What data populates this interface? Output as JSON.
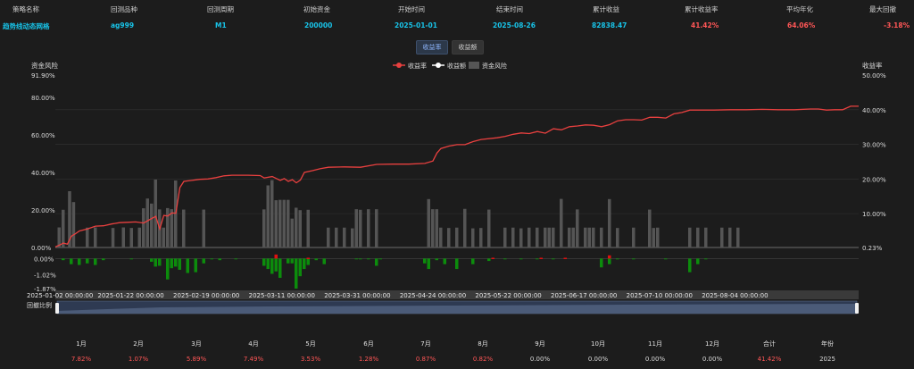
{
  "header": {
    "labels": [
      "策略名称",
      "回测品种",
      "回测周期",
      "初始资金",
      "开始时间",
      "结束时间",
      "累计收益",
      "累计收益率",
      "平均年化",
      "最大回撤"
    ],
    "values": [
      "趋势线动态网格",
      "ag999",
      "M1",
      "200000",
      "2025-01-01",
      "2025-08-26",
      "82838.47",
      "41.42%",
      "64.06%",
      "-3.18%"
    ]
  },
  "toggle": {
    "returns_rate": "收益率",
    "returns_amount": "收益额"
  },
  "chart_data": {
    "type": "line",
    "legend": [
      "收益率",
      "收益额",
      "资金风险"
    ],
    "legend_position": "top-center",
    "left_axis_title": "资金风险",
    "right_axis_title": "收益率",
    "left_ticks": [
      "91.90%",
      "80.00%",
      "60.00%",
      "40.00%",
      "20.00%",
      "0.00%"
    ],
    "right_ticks": [
      "50.00%",
      "40.00%",
      "30.00%",
      "20.00%",
      "10.00%",
      "0.23%"
    ],
    "right_ylim": [
      0.23,
      50.0
    ],
    "left_ylim": [
      0,
      91.9
    ],
    "sub_ticks": [
      "0.00%",
      "-1.02%",
      "-1.87%"
    ],
    "sub_ylim": [
      -1.87,
      0.3
    ],
    "x_ticks": [
      "2025-01-02 00:00:00",
      "2025-01-22 00:00:00",
      "2025-02-19 00:00:00",
      "2025-03-11 00:00:00",
      "2025-03-31 00:00:00",
      "2025-04-24 00:00:00",
      "2025-05-22 00:00:00",
      "2025-06-17 00:00:00",
      "2025-07-10 00:00:00",
      "2025-08-04 00:00:00"
    ],
    "slider_label": "回撤比例",
    "returns_series": [
      [
        0,
        0.4
      ],
      [
        0.005,
        0.9
      ],
      [
        0.01,
        1.5
      ],
      [
        0.015,
        1.2
      ],
      [
        0.02,
        3.5
      ],
      [
        0.025,
        4.2
      ],
      [
        0.03,
        5.0
      ],
      [
        0.04,
        5.6
      ],
      [
        0.05,
        6.4
      ],
      [
        0.06,
        6.5
      ],
      [
        0.07,
        7.0
      ],
      [
        0.08,
        7.4
      ],
      [
        0.09,
        7.5
      ],
      [
        0.1,
        7.6
      ],
      [
        0.11,
        7.3
      ],
      [
        0.12,
        8.6
      ],
      [
        0.125,
        9.2
      ],
      [
        0.13,
        5.6
      ],
      [
        0.135,
        9.5
      ],
      [
        0.14,
        9.3
      ],
      [
        0.145,
        10.2
      ],
      [
        0.15,
        10.1
      ],
      [
        0.155,
        17.5
      ],
      [
        0.16,
        19.3
      ],
      [
        0.17,
        19.6
      ],
      [
        0.18,
        19.9
      ],
      [
        0.19,
        20.0
      ],
      [
        0.2,
        20.4
      ],
      [
        0.21,
        20.9
      ],
      [
        0.22,
        21.1
      ],
      [
        0.24,
        21.1
      ],
      [
        0.255,
        21.0
      ],
      [
        0.26,
        20.3
      ],
      [
        0.27,
        20.7
      ],
      [
        0.28,
        19.6
      ],
      [
        0.285,
        20.1
      ],
      [
        0.29,
        19.3
      ],
      [
        0.295,
        19.8
      ],
      [
        0.3,
        18.9
      ],
      [
        0.305,
        19.7
      ],
      [
        0.31,
        21.9
      ],
      [
        0.32,
        22.4
      ],
      [
        0.33,
        23.0
      ],
      [
        0.34,
        23.4
      ],
      [
        0.36,
        23.5
      ],
      [
        0.38,
        23.4
      ],
      [
        0.4,
        24.2
      ],
      [
        0.42,
        24.3
      ],
      [
        0.44,
        24.3
      ],
      [
        0.46,
        24.5
      ],
      [
        0.47,
        25.2
      ],
      [
        0.475,
        27.5
      ],
      [
        0.48,
        28.8
      ],
      [
        0.49,
        29.5
      ],
      [
        0.5,
        29.9
      ],
      [
        0.51,
        29.9
      ],
      [
        0.52,
        30.8
      ],
      [
        0.53,
        31.4
      ],
      [
        0.55,
        31.9
      ],
      [
        0.56,
        32.3
      ],
      [
        0.57,
        32.9
      ],
      [
        0.58,
        33.3
      ],
      [
        0.59,
        33.1
      ],
      [
        0.6,
        33.7
      ],
      [
        0.61,
        33.2
      ],
      [
        0.62,
        34.5
      ],
      [
        0.63,
        34.2
      ],
      [
        0.64,
        35.1
      ],
      [
        0.65,
        35.3
      ],
      [
        0.66,
        35.6
      ],
      [
        0.67,
        35.5
      ],
      [
        0.68,
        35.1
      ],
      [
        0.69,
        35.7
      ],
      [
        0.7,
        36.8
      ],
      [
        0.71,
        37.1
      ],
      [
        0.72,
        37.1
      ],
      [
        0.73,
        37.0
      ],
      [
        0.74,
        37.8
      ],
      [
        0.75,
        37.8
      ],
      [
        0.76,
        37.6
      ],
      [
        0.77,
        38.8
      ],
      [
        0.78,
        39.2
      ],
      [
        0.79,
        39.9
      ],
      [
        0.8,
        39.9
      ],
      [
        0.82,
        39.9
      ],
      [
        0.84,
        40.0
      ],
      [
        0.86,
        40.0
      ],
      [
        0.88,
        40.1
      ],
      [
        0.9,
        40.0
      ],
      [
        0.92,
        40.0
      ],
      [
        0.94,
        40.2
      ],
      [
        0.95,
        40.2
      ],
      [
        0.96,
        39.9
      ],
      [
        0.97,
        40.0
      ],
      [
        0.98,
        40.0
      ],
      [
        0.99,
        41.0
      ],
      [
        1.0,
        41.0
      ]
    ],
    "risk_bars": [
      [
        0.005,
        10.7
      ],
      [
        0.01,
        20.1
      ],
      [
        0.018,
        30.0
      ],
      [
        0.023,
        24.2
      ],
      [
        0.04,
        10.6
      ],
      [
        0.05,
        10.7
      ],
      [
        0.072,
        10.4
      ],
      [
        0.085,
        10.7
      ],
      [
        0.095,
        10.4
      ],
      [
        0.105,
        10.6
      ],
      [
        0.11,
        20.9
      ],
      [
        0.115,
        26.1
      ],
      [
        0.12,
        23.4
      ],
      [
        0.125,
        36.2
      ],
      [
        0.13,
        20.3
      ],
      [
        0.135,
        10.6
      ],
      [
        0.14,
        21.0
      ],
      [
        0.145,
        20.4
      ],
      [
        0.15,
        35.7
      ],
      [
        0.16,
        20.2
      ],
      [
        0.185,
        20.2
      ],
      [
        0.26,
        20.3
      ],
      [
        0.265,
        33.1
      ],
      [
        0.27,
        35.9
      ],
      [
        0.275,
        25.2
      ],
      [
        0.28,
        25.4
      ],
      [
        0.285,
        25.4
      ],
      [
        0.29,
        25.4
      ],
      [
        0.295,
        15.4
      ],
      [
        0.3,
        21.2
      ],
      [
        0.305,
        19.9
      ],
      [
        0.315,
        20.1
      ],
      [
        0.34,
        10.6
      ],
      [
        0.35,
        10.6
      ],
      [
        0.36,
        10.6
      ],
      [
        0.37,
        10.2
      ],
      [
        0.375,
        20.4
      ],
      [
        0.38,
        20.1
      ],
      [
        0.39,
        20.4
      ],
      [
        0.4,
        20.4
      ],
      [
        0.465,
        25.8
      ],
      [
        0.47,
        20.4
      ],
      [
        0.475,
        20.4
      ],
      [
        0.48,
        10.6
      ],
      [
        0.49,
        10.4
      ],
      [
        0.5,
        10.6
      ],
      [
        0.51,
        20.6
      ],
      [
        0.52,
        10.2
      ],
      [
        0.53,
        10.4
      ],
      [
        0.54,
        20.2
      ],
      [
        0.56,
        10.6
      ],
      [
        0.57,
        10.6
      ],
      [
        0.58,
        10.2
      ],
      [
        0.59,
        10.6
      ],
      [
        0.6,
        10.6
      ],
      [
        0.61,
        10.6
      ],
      [
        0.615,
        10.6
      ],
      [
        0.62,
        10.6
      ],
      [
        0.63,
        25.9
      ],
      [
        0.64,
        10.6
      ],
      [
        0.645,
        10.6
      ],
      [
        0.65,
        20.3
      ],
      [
        0.66,
        10.6
      ],
      [
        0.665,
        10.6
      ],
      [
        0.67,
        10.6
      ],
      [
        0.68,
        10.6
      ],
      [
        0.69,
        25.8
      ],
      [
        0.7,
        10.4
      ],
      [
        0.72,
        10.6
      ],
      [
        0.74,
        20.2
      ],
      [
        0.745,
        10.4
      ],
      [
        0.75,
        10.6
      ],
      [
        0.79,
        10.6
      ],
      [
        0.8,
        10.6
      ],
      [
        0.81,
        10.6
      ],
      [
        0.83,
        10.6
      ],
      [
        0.84,
        10.6
      ],
      [
        0.85,
        10.6
      ]
    ],
    "drawdown_bars": [
      [
        0.01,
        -0.1
      ],
      [
        0.02,
        -0.35
      ],
      [
        0.03,
        -0.4
      ],
      [
        0.04,
        -0.3
      ],
      [
        0.05,
        -0.4
      ],
      [
        0.06,
        -0.1
      ],
      [
        0.095,
        -0.05
      ],
      [
        0.12,
        -0.2
      ],
      [
        0.125,
        -0.5
      ],
      [
        0.13,
        -0.45
      ],
      [
        0.14,
        -1.3
      ],
      [
        0.145,
        -0.6
      ],
      [
        0.15,
        -0.5
      ],
      [
        0.155,
        -0.7
      ],
      [
        0.165,
        -0.9
      ],
      [
        0.175,
        -0.85
      ],
      [
        0.185,
        -0.3
      ],
      [
        0.195,
        -0.05
      ],
      [
        0.205,
        -0.1
      ],
      [
        0.225,
        -0.05
      ],
      [
        0.26,
        -0.45
      ],
      [
        0.265,
        -0.65
      ],
      [
        0.27,
        -0.95
      ],
      [
        0.275,
        -0.8
      ],
      [
        0.28,
        -1.2
      ],
      [
        0.29,
        -0.3
      ],
      [
        0.295,
        -0.3
      ],
      [
        0.3,
        -1.87
      ],
      [
        0.305,
        -1.1
      ],
      [
        0.31,
        -0.65
      ],
      [
        0.315,
        -0.4
      ],
      [
        0.325,
        -0.1
      ],
      [
        0.335,
        -0.35
      ],
      [
        0.375,
        -0.05
      ],
      [
        0.38,
        -0.05
      ],
      [
        0.39,
        -0.05
      ],
      [
        0.4,
        -0.45
      ],
      [
        0.405,
        -0.05
      ],
      [
        0.46,
        -0.3
      ],
      [
        0.465,
        -0.65
      ],
      [
        0.475,
        -0.1
      ],
      [
        0.485,
        -0.35
      ],
      [
        0.5,
        -0.65
      ],
      [
        0.52,
        -0.35
      ],
      [
        0.54,
        -0.15
      ],
      [
        0.56,
        -0.05
      ],
      [
        0.58,
        -0.05
      ],
      [
        0.6,
        -0.05
      ],
      [
        0.62,
        -0.05
      ],
      [
        0.68,
        -0.55
      ],
      [
        0.69,
        -0.35
      ],
      [
        0.7,
        -0.05
      ],
      [
        0.72,
        -0.05
      ],
      [
        0.76,
        -0.05
      ],
      [
        0.79,
        -0.85
      ],
      [
        0.8,
        -0.35
      ],
      [
        0.81,
        -0.05
      ]
    ],
    "drawdown_red_bars": [
      [
        0.275,
        0.25
      ],
      [
        0.315,
        0.05
      ],
      [
        0.545,
        0.05
      ],
      [
        0.605,
        0.05
      ],
      [
        0.635,
        0.05
      ],
      [
        0.69,
        0.2
      ]
    ]
  },
  "monthly": {
    "headers": [
      "1月",
      "2月",
      "3月",
      "4月",
      "5月",
      "6月",
      "7月",
      "8月",
      "9月",
      "10月",
      "11月",
      "12月",
      "合计",
      "年份"
    ],
    "values": [
      "7.82%",
      "1.07%",
      "5.89%",
      "7.49%",
      "3.53%",
      "1.28%",
      "0.87%",
      "0.82%",
      "0.00%",
      "0.00%",
      "0.00%",
      "0.00%",
      "41.42%",
      "2025"
    ]
  },
  "colors": {
    "returns_line": "#e8403f",
    "risk_bar": "#555555",
    "drawdown_down": "#0c8c0c",
    "drawdown_up": "#e01010",
    "accent": "#18c3e8"
  }
}
